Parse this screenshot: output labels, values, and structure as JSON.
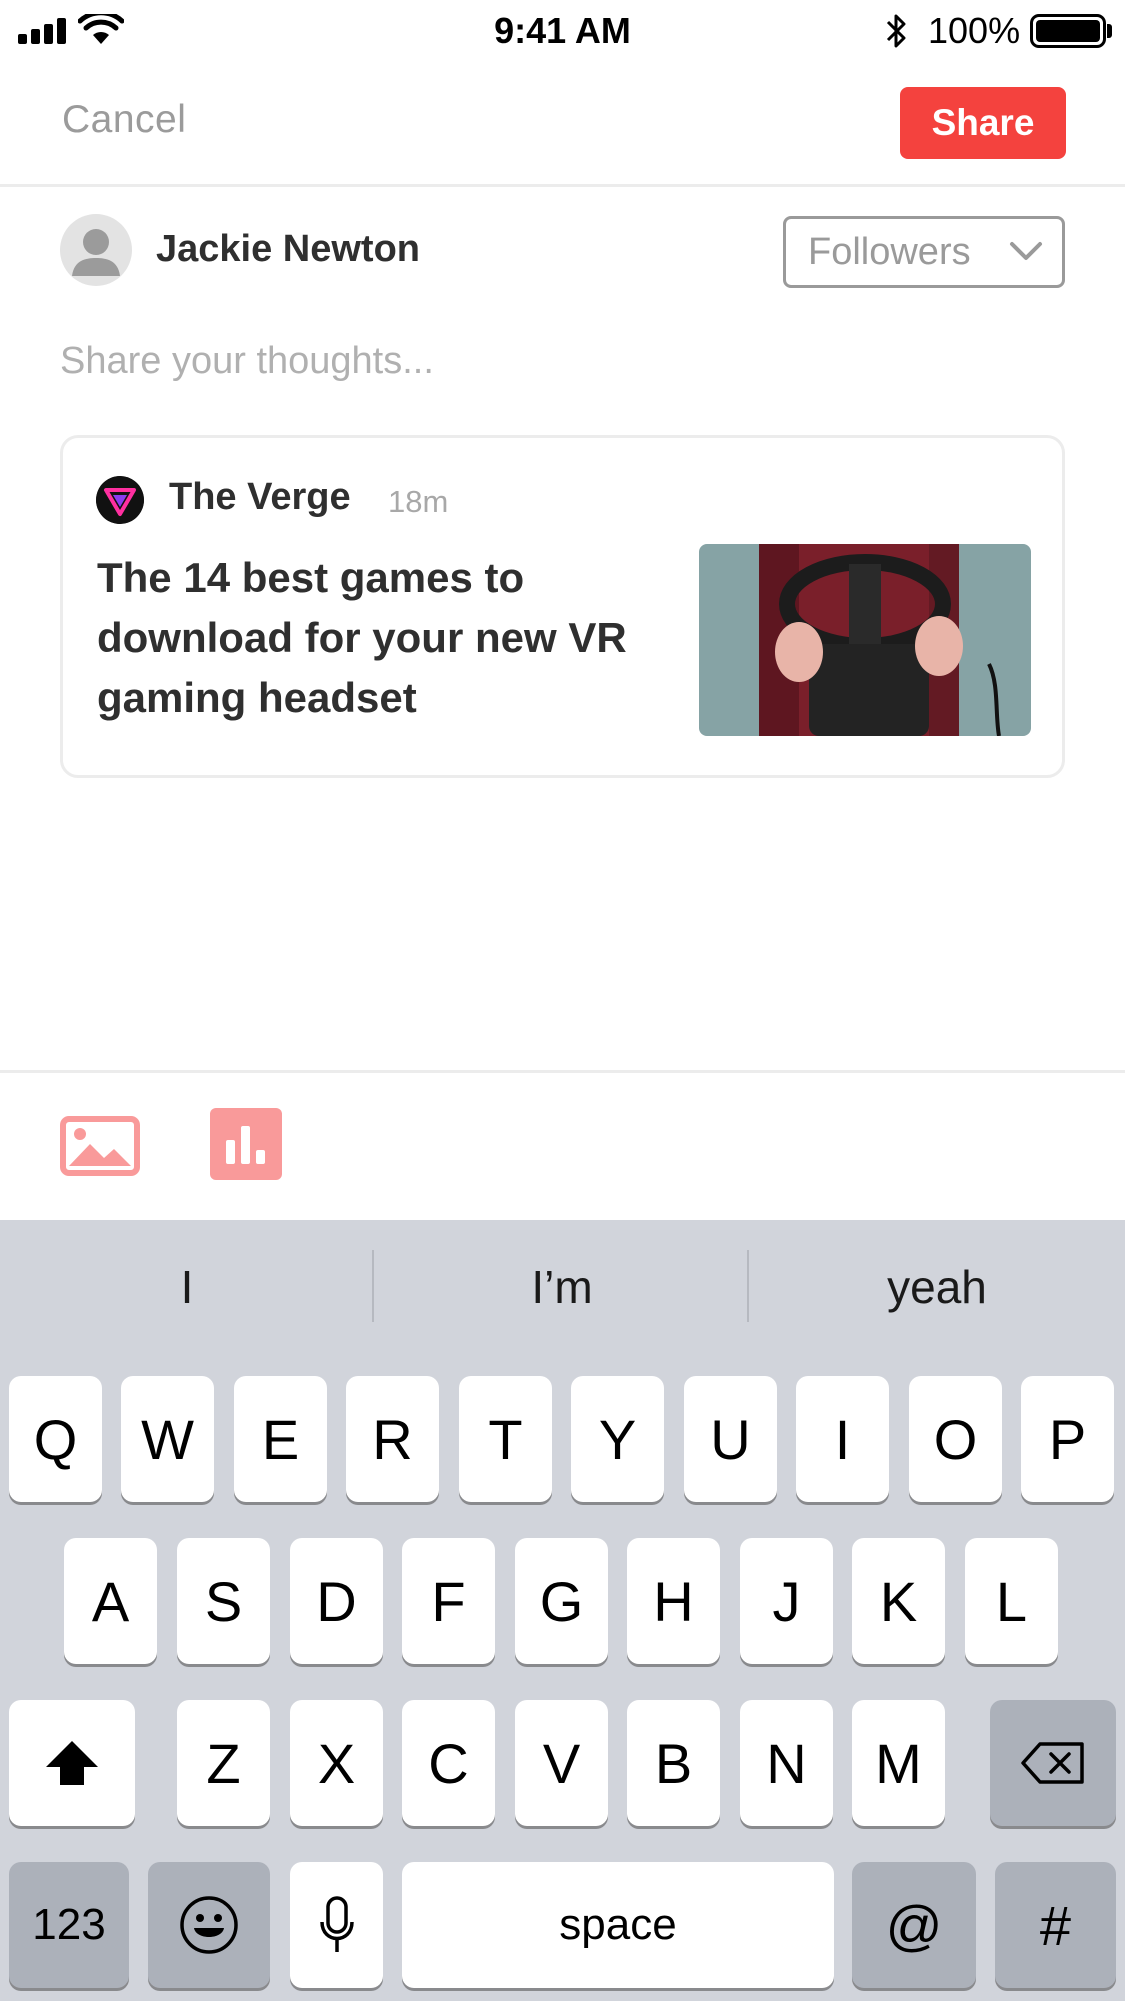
{
  "status_bar": {
    "time": "9:41 AM",
    "battery_text": "100%",
    "icons": [
      "signal-icon",
      "wifi-icon",
      "bluetooth-icon",
      "battery-icon"
    ]
  },
  "nav": {
    "cancel_label": "Cancel",
    "share_label": "Share",
    "accent_color": "#f4423e"
  },
  "author": {
    "name": "Jackie Newton",
    "audience": "Followers"
  },
  "composer": {
    "placeholder": "Share your thoughts..."
  },
  "article": {
    "source": "The Verge",
    "age": "18m",
    "title": "The 14 best games to download for your new VR gaming headset"
  },
  "attach": {
    "icons": [
      "image-icon",
      "poll-icon"
    ]
  },
  "keyboard": {
    "suggestions": [
      "I",
      "I’m",
      "yeah"
    ],
    "row1": [
      "Q",
      "W",
      "E",
      "R",
      "T",
      "Y",
      "U",
      "I",
      "O",
      "P"
    ],
    "row2": [
      "A",
      "S",
      "D",
      "F",
      "G",
      "H",
      "J",
      "K",
      "L"
    ],
    "row3": [
      "Z",
      "X",
      "C",
      "V",
      "B",
      "N",
      "M"
    ],
    "numbers_label": "123",
    "space_label": "space",
    "at_label": "@",
    "hash_label": "#"
  }
}
